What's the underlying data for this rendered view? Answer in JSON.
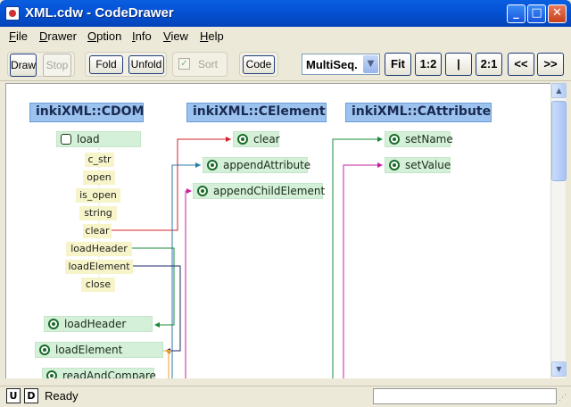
{
  "window": {
    "title": "XML.cdw - CodeDrawer",
    "minimize": "_",
    "maximize": "□",
    "close": "✕"
  },
  "menu": {
    "items": [
      "File",
      "Drawer",
      "Option",
      "Info",
      "View",
      "Help"
    ]
  },
  "toolbar": {
    "draw": "Draw",
    "stop": "Stop",
    "fold": "Fold",
    "unfold": "Unfold",
    "sort": "Sort",
    "sort_checked": true,
    "code": "Code",
    "select_value": "MultiSeq.",
    "fit": "Fit",
    "zoom_half": "1:2",
    "zoom_one": "|",
    "zoom_double": "2:1",
    "prev": "<<",
    "next": ">>"
  },
  "diagram": {
    "classes": [
      {
        "name": "inkiXML::CDOM",
        "methods": [
          "load",
          "loadHeader",
          "loadElement",
          "readAndCompare"
        ],
        "calls": [
          "c_str",
          "open",
          "is_open",
          "string",
          "clear",
          "loadHeader",
          "loadElement",
          "close"
        ]
      },
      {
        "name": "inkiXML::CElement",
        "methods": [
          "clear",
          "appendAttribute",
          "appendChildElement"
        ]
      },
      {
        "name": "inkiXML::CAttribute",
        "methods": [
          "setName",
          "setValue"
        ]
      }
    ],
    "link_colors": {
      "clear": "#d0202a",
      "appendAttribute": "#2a7aa8",
      "appendChildElement": "#c820a0",
      "loadHeader": "#1a8a3a",
      "loadElement": "#1a2a6a",
      "setName": "#1a8a3a",
      "setValue": "#c820a0",
      "return": "#e8a030"
    }
  },
  "status": {
    "u_button": "U",
    "d_button": "D",
    "text": "Ready"
  },
  "icons": {
    "app": "codedrawer-app-icon",
    "method": "method-dot-icon",
    "dropdown": "chevron-down-icon"
  }
}
